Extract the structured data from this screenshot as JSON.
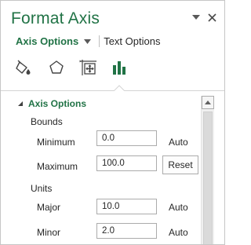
{
  "pane": {
    "title": "Format Axis",
    "menu_icon": "chevron-down-icon",
    "close_icon": "close-icon"
  },
  "tabs": {
    "active": "Axis Options",
    "other": "Text Options"
  },
  "icon_tabs": [
    {
      "name": "fill-line-icon"
    },
    {
      "name": "effects-icon"
    },
    {
      "name": "size-properties-icon"
    },
    {
      "name": "axis-options-icon",
      "selected": true
    }
  ],
  "section": {
    "title": "Axis Options",
    "bounds": {
      "label": "Bounds",
      "minimum_label": "Minimum",
      "minimum_value": "0.0",
      "minimum_state": "Auto",
      "maximum_label": "Maximum",
      "maximum_value": "100.0",
      "maximum_action": "Reset"
    },
    "units": {
      "label": "Units",
      "major_label": "Major",
      "major_value": "10.0",
      "major_state": "Auto",
      "minor_label": "Minor",
      "minor_value": "2.0",
      "minor_state": "Auto"
    }
  },
  "colors": {
    "accent": "#217346",
    "text": "#262626",
    "border": "#ababab"
  }
}
